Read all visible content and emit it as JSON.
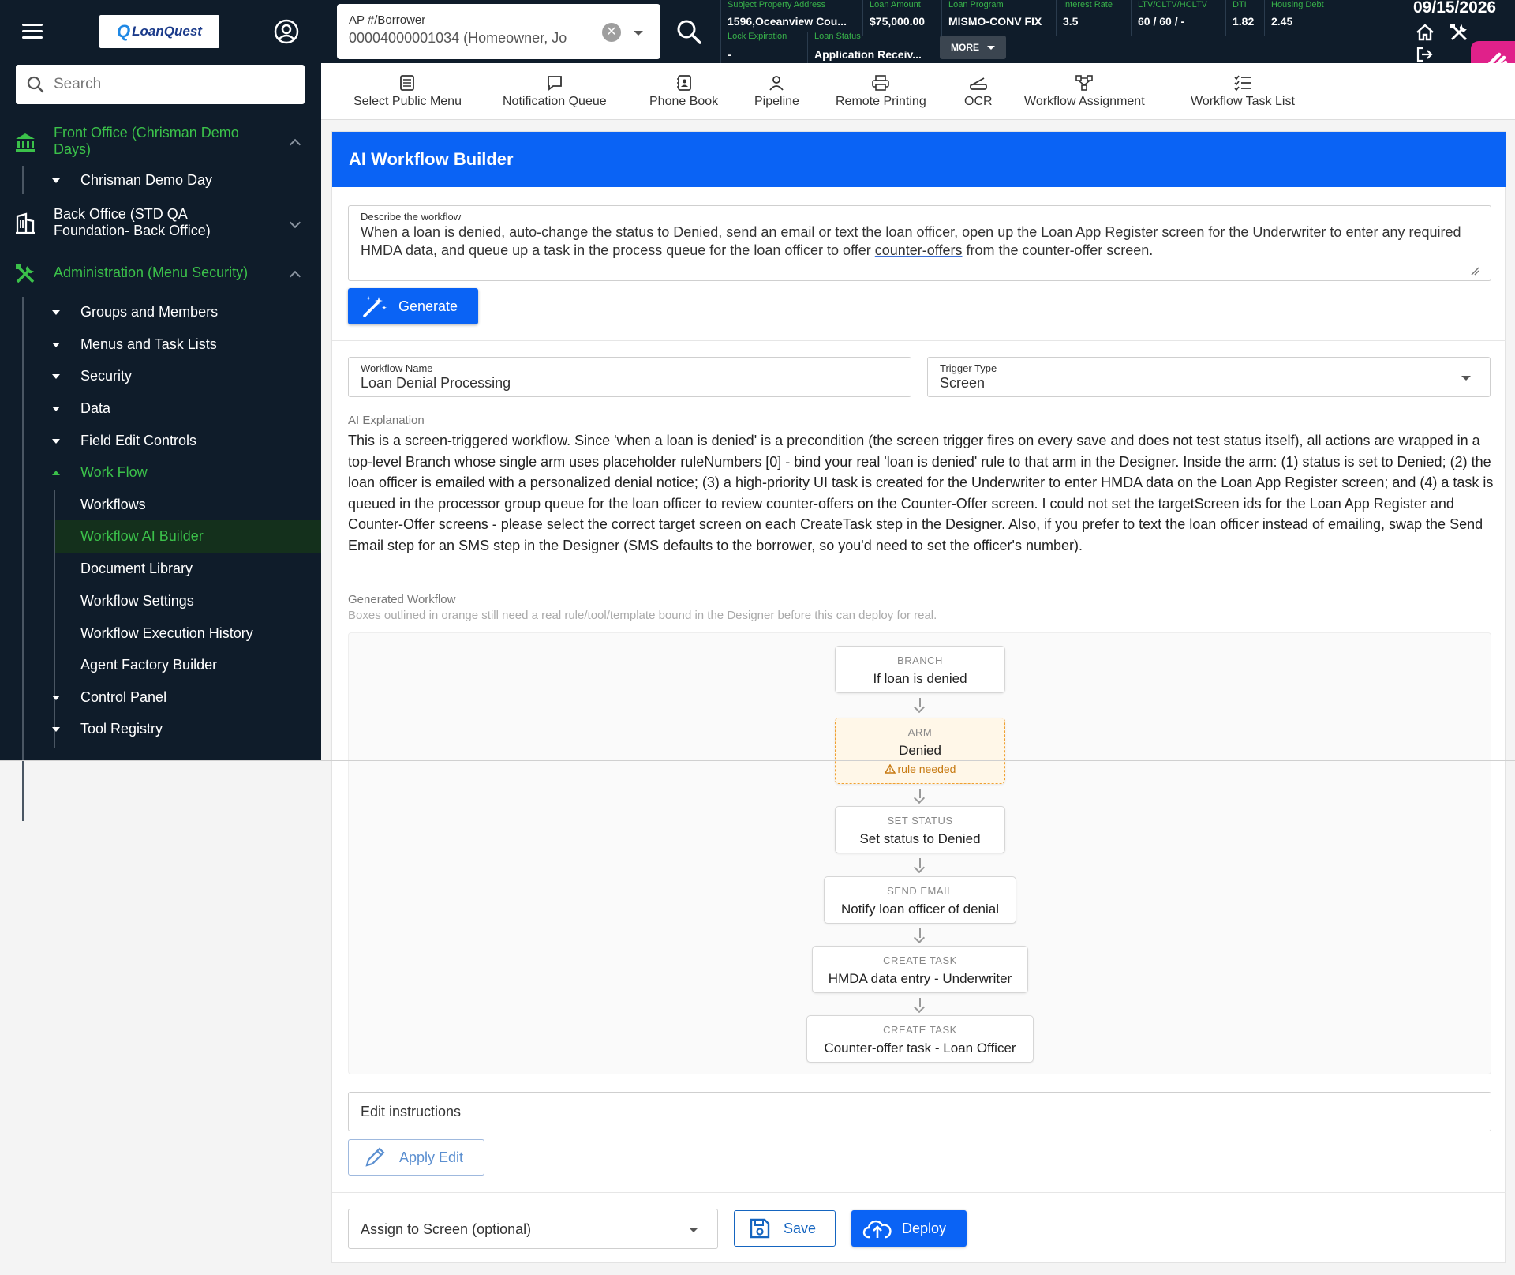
{
  "topbar": {
    "logo_text": "LoanQuest",
    "borrower_label": "AP #/Borrower",
    "borrower_value": "00004000001034 (Homeowner, Jo",
    "clear_glyph": "✕",
    "info": [
      {
        "label": "Subject Property Address",
        "value": "1596,Oceanview Cou..."
      },
      {
        "label": "Loan Amount",
        "value": "$75,000.00"
      },
      {
        "label": "Loan Program",
        "value": "MISMO-CONV FIX"
      },
      {
        "label": "Interest Rate",
        "value": "3.5"
      },
      {
        "label": "LTV/CLTV/HCLTV",
        "value": "60 / 60 / -"
      },
      {
        "label": "DTI",
        "value": "1.82"
      },
      {
        "label": "Housing Debt",
        "value": "2.45"
      },
      {
        "label": "Lock Expiration",
        "value": "-"
      },
      {
        "label": "Loan Status",
        "value": "Application Receiv..."
      }
    ],
    "more_label": "MORE",
    "date": "09/15/2026"
  },
  "sidebar": {
    "search_placeholder": "Search",
    "groups": [
      {
        "label": "Front Office (Chrisman Demo Days)"
      },
      {
        "label": "Back Office (STD QA Foundation- Back Office)"
      },
      {
        "label": "Administration (Menu Security)"
      }
    ],
    "items": [
      {
        "label": "Chrisman Demo Day"
      },
      {
        "label": "Groups and Members"
      },
      {
        "label": "Menus and Task Lists"
      },
      {
        "label": "Security"
      },
      {
        "label": "Data"
      },
      {
        "label": "Field Edit Controls"
      },
      {
        "label": "Work Flow"
      },
      {
        "label": "Workflows"
      },
      {
        "label": "Workflow AI Builder"
      },
      {
        "label": "Document Library"
      },
      {
        "label": "Workflow Settings"
      },
      {
        "label": "Workflow Execution History"
      },
      {
        "label": "Agent Factory Builder"
      },
      {
        "label": "Control Panel"
      },
      {
        "label": "Tool Registry"
      }
    ]
  },
  "toolbar": {
    "items": [
      {
        "label": "Select Public Menu",
        "icon": "menu-list-icon"
      },
      {
        "label": "Notification Queue",
        "icon": "chat-bubble-icon"
      },
      {
        "label": "Phone Book",
        "icon": "contact-book-icon"
      },
      {
        "label": "Pipeline",
        "icon": "person-icon"
      },
      {
        "label": "Remote Printing",
        "icon": "printer-icon"
      },
      {
        "label": "OCR",
        "icon": "scanner-icon"
      },
      {
        "label": "Workflow Assignment",
        "icon": "workflow-nodes-icon"
      },
      {
        "label": "Workflow Task List",
        "icon": "checklist-icon"
      }
    ]
  },
  "builder": {
    "title": "AI Workflow Builder",
    "describe_label": "Describe the workflow",
    "describe_before": "When a loan is denied, auto-change the status to Denied, send an email or text the loan officer, open up the Loan App Register screen for the Underwriter to enter any required HMDA data, and queue up a task in the process queue for the loan officer to offer ",
    "describe_link": "counter-offers",
    "describe_after": " from the counter-offer screen.",
    "generate_label": "Generate",
    "workflow_name_label": "Workflow Name",
    "workflow_name_value": "Loan Denial Processing",
    "trigger_type_label": "Trigger Type",
    "trigger_type_value": "Screen",
    "ai_explanation_label": "AI Explanation",
    "ai_explanation": "This is a screen-triggered workflow. Since 'when a loan is denied' is a precondition (the screen trigger fires on every save and does not test status itself), all actions are wrapped in a top-level Branch whose single arm uses placeholder ruleNumbers [0] - bind your real 'loan is denied' rule to that arm in the Designer. Inside the arm: (1) status is set to Denied; (2) the loan officer is emailed with a personalized denial notice; (3) a high-priority UI task is created for the Underwriter to enter HMDA data on the Loan App Register screen; and (4) a task is queued in the processor group queue for the loan officer to review counter-offers on the Counter-Offer screen. I could not set the targetScreen ids for the Loan App Register and Counter-Offer screens - please select the correct target screen on each CreateTask step in the Designer. Also, if you prefer to text the loan officer instead of emailing, swap the Send Email step for an SMS step in the Designer (SMS defaults to the borrower, so you'd need to set the officer's number).",
    "generated_label": "Generated Workflow",
    "generated_hint": "Boxes outlined in orange still need a real rule/tool/template bound in the Designer before this can deploy for real.",
    "nodes": [
      {
        "type": "BRANCH",
        "label": "If loan is denied"
      },
      {
        "type": "ARM",
        "label": "Denied",
        "warning": "rule needed"
      },
      {
        "type": "SET STATUS",
        "label": "Set status to Denied"
      },
      {
        "type": "SEND EMAIL",
        "label": "Notify loan officer of denial"
      },
      {
        "type": "CREATE TASK",
        "label": "HMDA data entry - Underwriter"
      },
      {
        "type": "CREATE TASK",
        "label": "Counter-offer task - Loan Officer"
      }
    ],
    "edit_placeholder": "Edit instructions",
    "apply_edit_label": "Apply Edit",
    "assign_placeholder": "Assign to Screen (optional)",
    "save_label": "Save",
    "deploy_label": "Deploy",
    "colors": {
      "primary": "#0a63f5",
      "nav_green": "#3bc14a",
      "sidebar_bg": "#0f1c2a",
      "warn_orange": "#f0a030"
    }
  }
}
